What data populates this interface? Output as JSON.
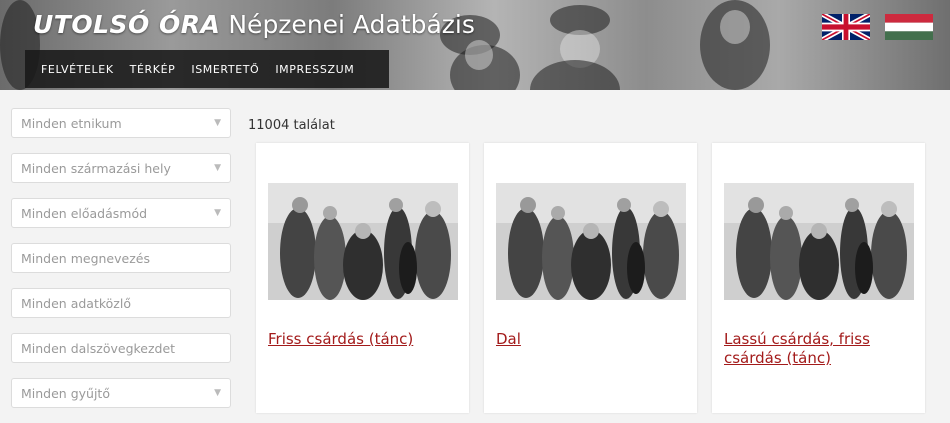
{
  "header": {
    "brand": "UTOLSÓ ÓRA",
    "subtitle": "Népzenei Adatbázis",
    "nav": [
      "FELVÉTELEK",
      "TÉRKÉP",
      "ISMERTETŐ",
      "IMPRESSZUM"
    ],
    "flags": [
      "uk-flag-icon",
      "hungary-flag-icon"
    ]
  },
  "filters": {
    "ethnicity": "Minden etnikum",
    "origin": "Minden származási hely",
    "performance": "Minden előadásmód",
    "name": "Minden megnevezés",
    "informant": "Minden adatközlő",
    "lyrics_start": "Minden dalszövegkezdet",
    "collector": "Minden gyűjtő"
  },
  "results": {
    "count": "11004 találat",
    "cards": [
      {
        "title": "Friss csárdás (tánc)"
      },
      {
        "title": "Dal"
      },
      {
        "title": "Lassú csárdás, friss csárdás (tánc)"
      }
    ]
  },
  "colors": {
    "link": "#a31b1b",
    "nav_bg": "#191919"
  }
}
